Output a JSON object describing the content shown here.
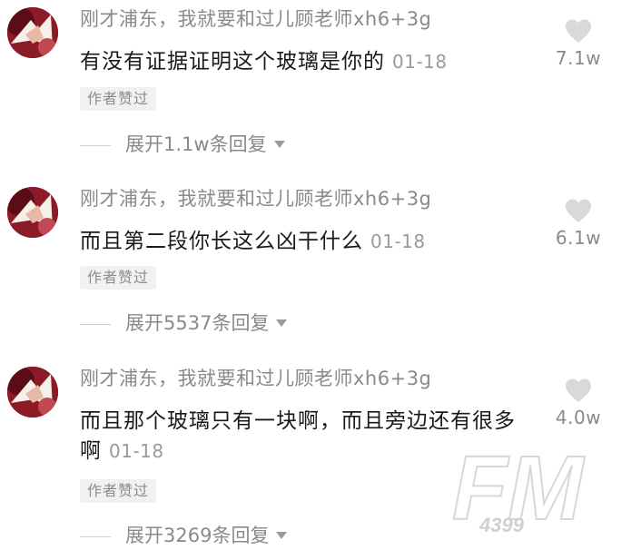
{
  "comments": [
    {
      "username": "刚才浦东，我就要和过儿顾老师xh6+3g",
      "content": "有没有证据证明这个玻璃是你的",
      "date": "01-18",
      "badge": "作者赞过",
      "replies": "展开1.1w条回复",
      "likes": "7.1w"
    },
    {
      "username": "刚才浦东，我就要和过儿顾老师xh6+3g",
      "content": "而且第二段你长这么凶干什么",
      "date": "01-18",
      "badge": "作者赞过",
      "replies": "展开5537条回复",
      "likes": "6.1w"
    },
    {
      "username": "刚才浦东，我就要和过儿顾老师xh6+3g",
      "content": "而且那个玻璃只有一块啊，而且旁边还有很多啊",
      "date": "01-18",
      "badge": "作者赞过",
      "replies": "展开3269条回复",
      "likes": "4.0w"
    }
  ],
  "icons": {
    "like": "heart-icon",
    "expand": "caret-down-icon"
  },
  "watermark": {
    "main": "FM",
    "sub": "4399"
  },
  "colors": {
    "text_primary": "#1a1a1a",
    "text_secondary": "#8a8a8a",
    "heart": "#d9d9d9",
    "badge_bg": "#f1f1f1"
  }
}
